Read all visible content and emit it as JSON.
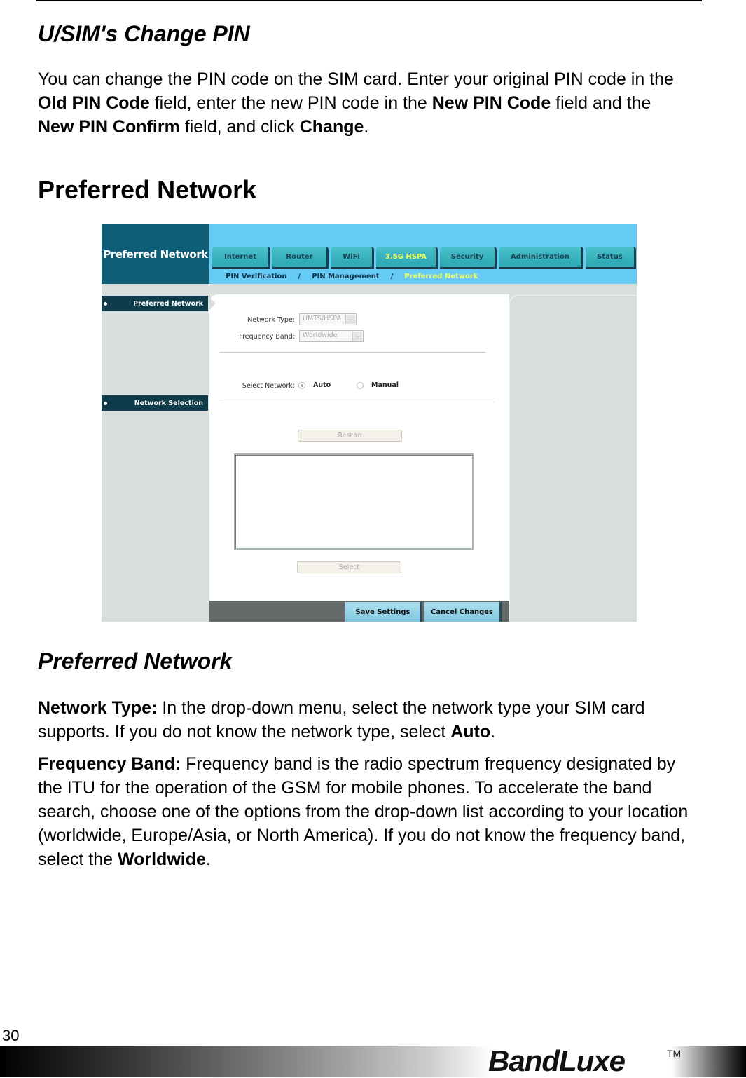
{
  "section1": {
    "title": "U/SIM's Change PIN",
    "body": [
      {
        "t": "You can change the PIN code on the SIM card. Enter your original PIN code in the ",
        "b": false
      },
      {
        "t": "Old PIN Code",
        "b": true
      },
      {
        "t": " field, enter the new PIN code in the ",
        "b": false
      },
      {
        "t": "New PIN Code",
        "b": true
      },
      {
        "t": " field and the ",
        "b": false
      },
      {
        "t": "New PIN Confirm",
        "b": true
      },
      {
        "t": " field, and click ",
        "b": false
      },
      {
        "t": "Change",
        "b": true
      },
      {
        "t": ".",
        "b": false
      }
    ]
  },
  "section2": {
    "title": "Preferred Network"
  },
  "screenshot": {
    "logo_title": "Preferred Network",
    "tabs": [
      {
        "label": "Internet",
        "active": false
      },
      {
        "label": "Router",
        "active": false
      },
      {
        "label": "WiFi",
        "active": false
      },
      {
        "label": "3.5G HSPA",
        "active": true
      },
      {
        "label": "Security",
        "active": false
      },
      {
        "label": "Administration",
        "active": false
      },
      {
        "label": "Status",
        "active": false
      }
    ],
    "breadcrumb": {
      "item1": "PIN Verification",
      "sep": "/",
      "item2": "PIN Management",
      "current": "Preferred Network"
    },
    "sidebar": {
      "item1": "Preferred Network",
      "item2": "Network Selection"
    },
    "form": {
      "network_type_label": "Network Type:",
      "network_type_value": "UMTS/HSPA",
      "frequency_band_label": "Frequency Band:",
      "frequency_band_value": "Worldwide",
      "select_network_label": "Select Network:",
      "radio_auto": "Auto",
      "radio_manual": "Manual",
      "selected_network": "Auto",
      "rescan_button": "Rescan",
      "select_button": "Select"
    },
    "actions": {
      "save": "Save Settings",
      "cancel": "Cancel Changes"
    },
    "colors": {
      "accent_yellow": "#f3ff5c",
      "header_blue": "#66ccf6",
      "logo_teal": "#0e5e77"
    }
  },
  "section3": {
    "title": "Preferred Network",
    "p1": [
      {
        "t": "Network Type:",
        "b": true
      },
      {
        "t": " In the drop-down menu, select the network type your SIM card supports. If you do not know the network type, select ",
        "b": false
      },
      {
        "t": "Auto",
        "b": true
      },
      {
        "t": ".",
        "b": false
      }
    ],
    "p2": [
      {
        "t": "Frequency Band:",
        "b": true
      },
      {
        "t": " Frequency band is the radio spectrum frequency designated by the ITU for the operation of the GSM for mobile phones. To accelerate the band search, choose one of the options from the drop-down list according to your location (worldwide, Europe/Asia, or North America). If you do not know the frequency band, select the ",
        "b": false
      },
      {
        "t": "Worldwide",
        "b": true
      },
      {
        "t": ".",
        "b": false
      }
    ]
  },
  "footer": {
    "page_number": "30",
    "brand": "BandLuxe",
    "trademark": "TM"
  }
}
